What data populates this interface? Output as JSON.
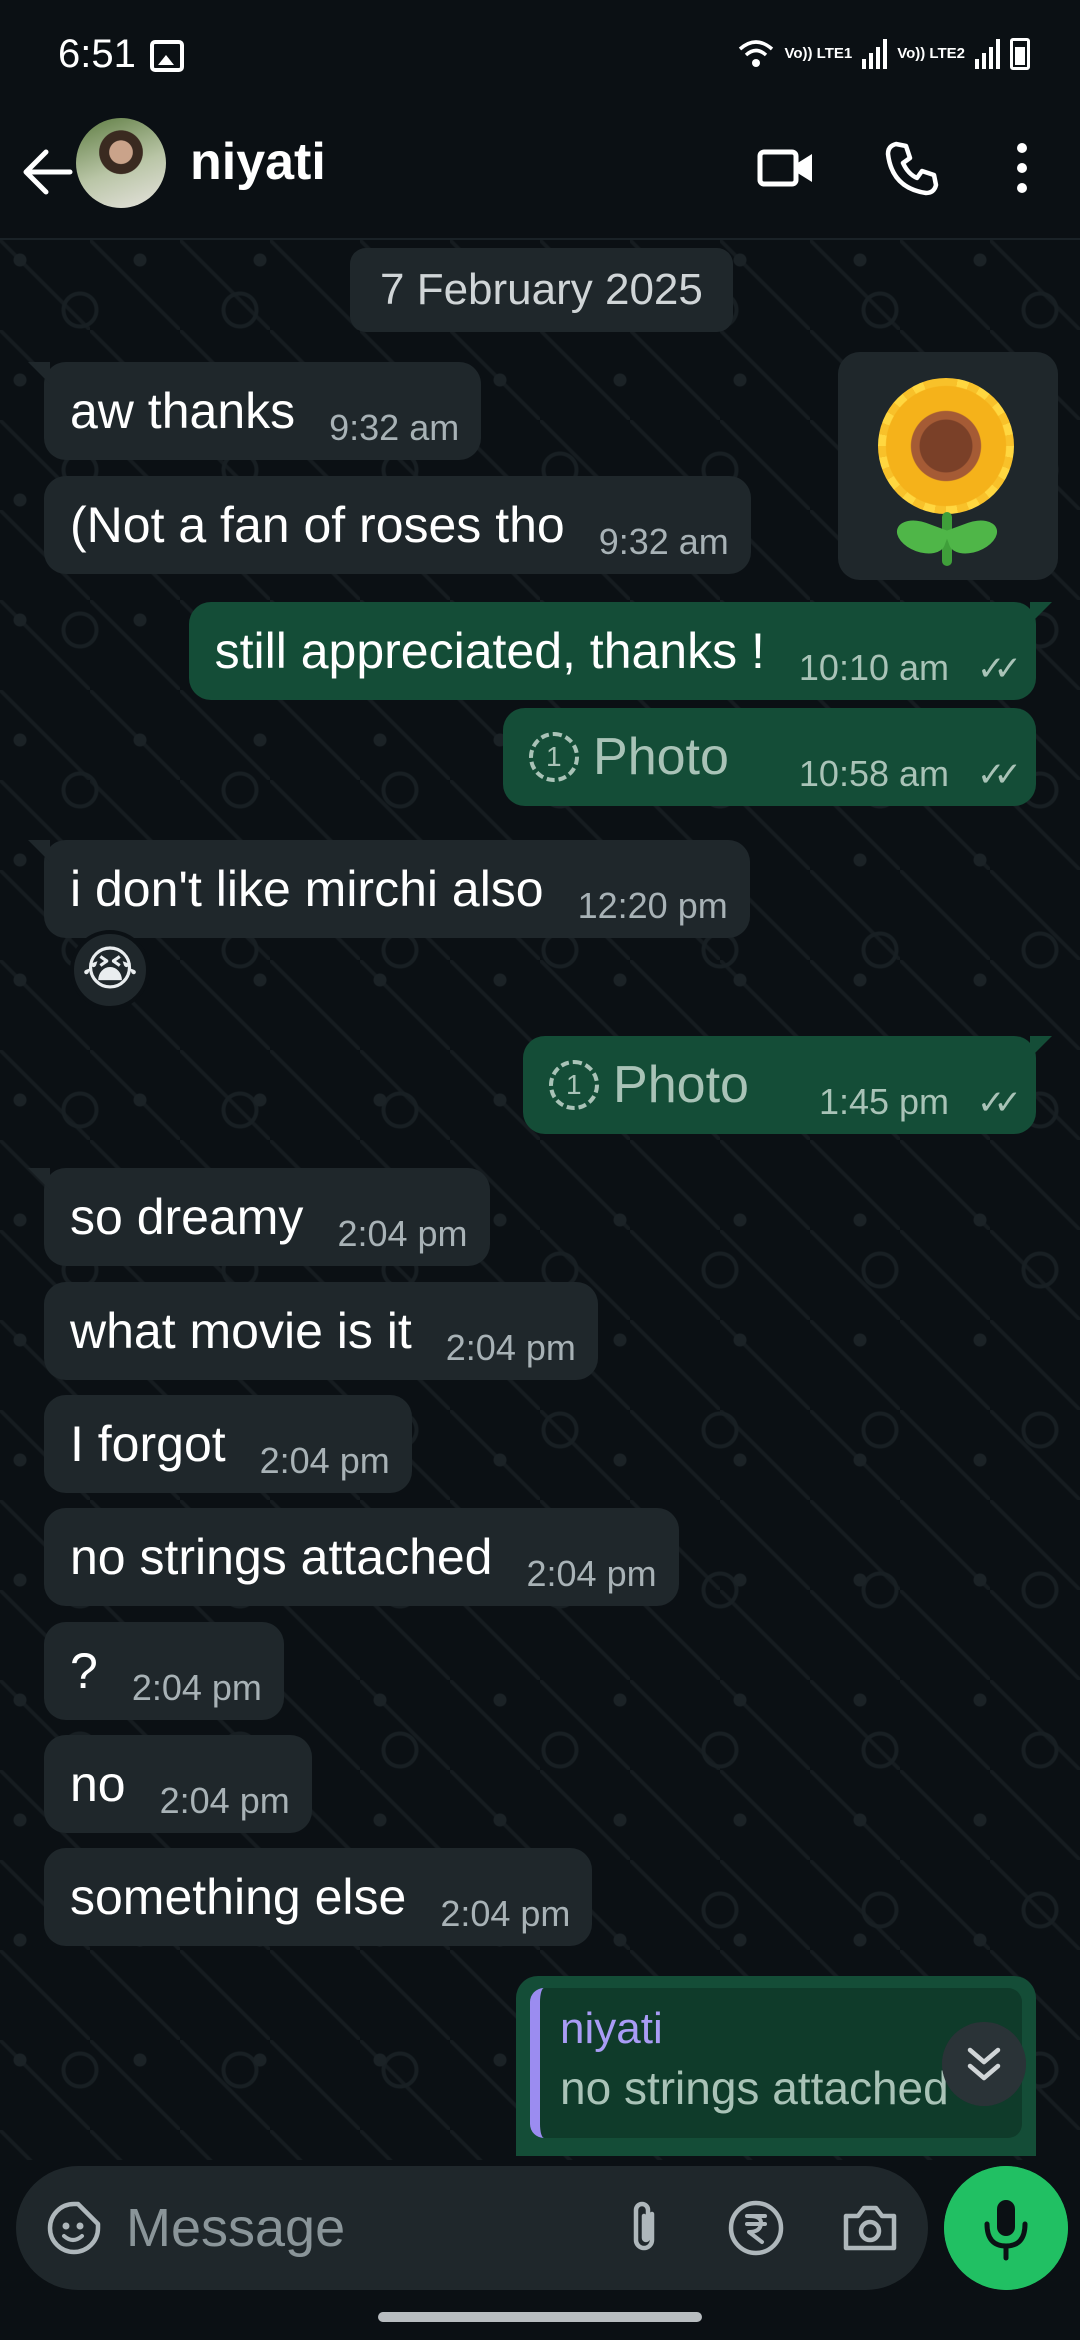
{
  "status_bar": {
    "time": "6:51",
    "sim1": "Vo)) LTE1",
    "sim2": "Vo)) LTE2"
  },
  "header": {
    "contact_name": "niyati",
    "icons": [
      "back-arrow-icon",
      "video-call-icon",
      "voice-call-icon",
      "more-options-icon"
    ]
  },
  "chat": {
    "date_chip": "7 February 2025",
    "messages": [
      {
        "dir": "in",
        "text": "aw thanks",
        "time": "9:32 am"
      },
      {
        "dir": "in",
        "text": "(Not a fan of roses tho",
        "time": "9:32 am"
      },
      {
        "dir": "out",
        "text": "still appreciated, thanks !",
        "time": "10:10 am",
        "ticks": "✓✓"
      },
      {
        "dir": "out",
        "text": "Photo",
        "time": "10:58 am",
        "ticks": "✓✓",
        "kind": "photo"
      },
      {
        "dir": "in",
        "text": "i don't like mirchi also",
        "time": "12:20 pm"
      },
      {
        "dir": "out",
        "text": "Photo",
        "time": "1:45 pm",
        "ticks": "✓✓",
        "kind": "photo"
      },
      {
        "dir": "in",
        "text": "so dreamy",
        "time": "2:04 pm"
      },
      {
        "dir": "in",
        "text": "what movie is it",
        "time": "2:04 pm"
      },
      {
        "dir": "in",
        "text": "I forgot",
        "time": "2:04 pm"
      },
      {
        "dir": "in",
        "text": "no strings attached",
        "time": "2:04 pm"
      },
      {
        "dir": "in",
        "text": "?",
        "time": "2:04 pm"
      },
      {
        "dir": "in",
        "text": "no",
        "time": "2:04 pm"
      },
      {
        "dir": "in",
        "text": "something else",
        "time": "2:04 pm"
      }
    ],
    "sticker": "sunflower",
    "reaction": "😭",
    "reply": {
      "name": "niyati",
      "text": "no strings attached"
    }
  },
  "composer": {
    "placeholder": "Message",
    "icons": [
      "emoji-sticker-icon",
      "attach-icon",
      "rupee-payment-icon",
      "camera-icon",
      "mic-icon"
    ]
  },
  "colors": {
    "background": "#0b1014",
    "incoming_bubble": "#1f272b",
    "outgoing_bubble": "#144d37",
    "accent_green": "#21c063",
    "reply_name": "#a99cf5"
  }
}
